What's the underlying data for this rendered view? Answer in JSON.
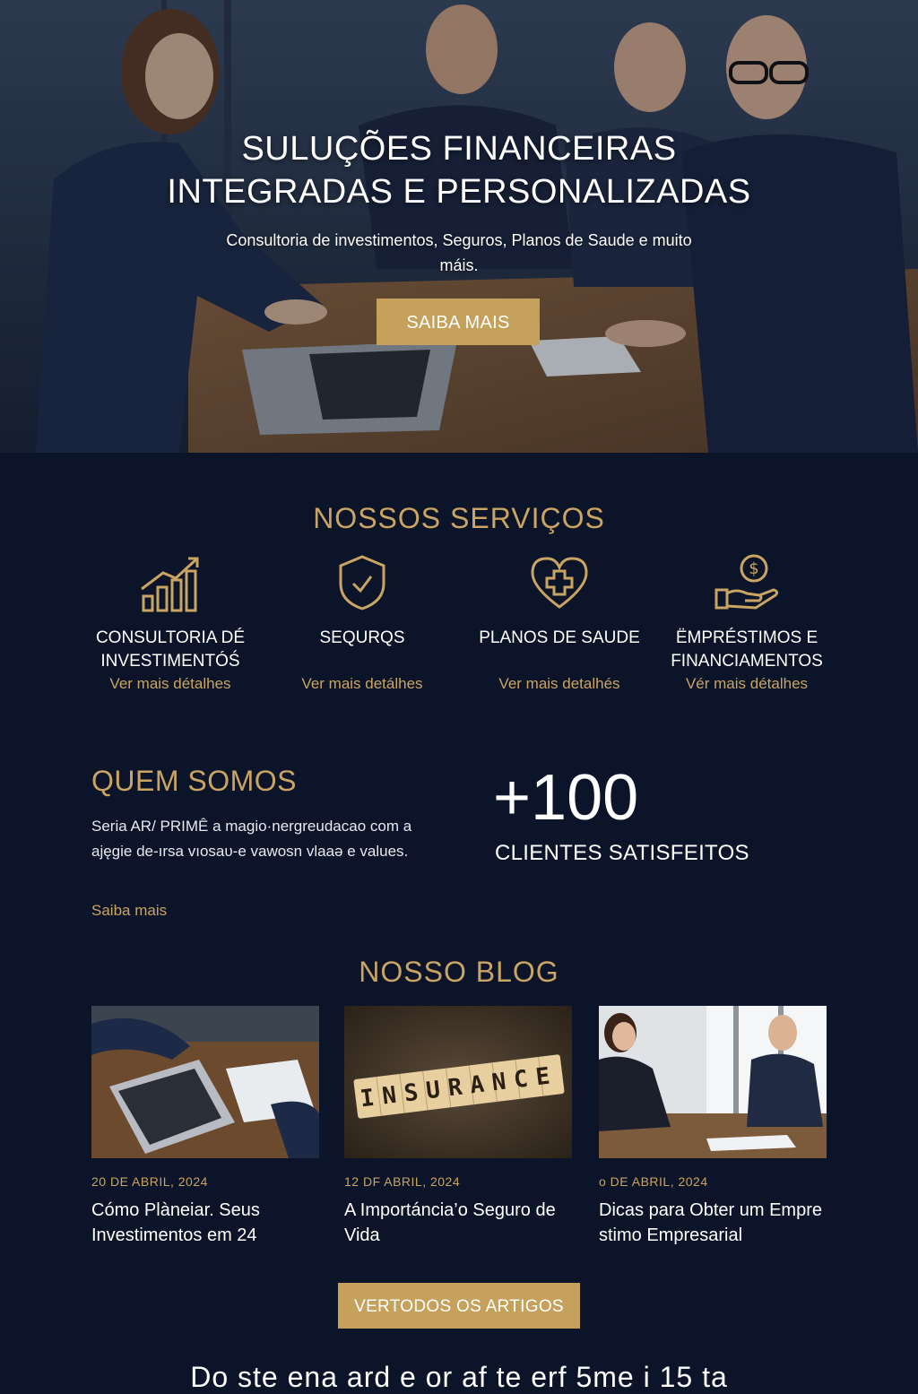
{
  "hero": {
    "title_line1": "SULUÇÕES FINANCEIRAS",
    "title_line2": "INTEGRADAS E PERSONALIZADAS",
    "subtitle": "Consultoria de investimentos, Seguros, Planos de Saude e muito máis.",
    "cta_label": "SAIBA MAIS"
  },
  "services": {
    "title": "NOSSOS SERVIÇOS",
    "items": [
      {
        "icon": "bar-chart-growth-icon",
        "name": "CONSULTORIA DÉ INVESTIMENTÓŚ",
        "link": "Ver mais détalhes"
      },
      {
        "icon": "shield-check-icon",
        "name": "SEQURQS",
        "link": "Ver mais detálhes"
      },
      {
        "icon": "heart-plus-icon",
        "name": "PLANOS DE SAUDE",
        "link": "Ver mais detalhés"
      },
      {
        "icon": "hand-coin-icon",
        "name": "ËMPRÉSTIMOS E FINANCIAMENTOS",
        "link": "Vér mais détalhes"
      }
    ]
  },
  "about": {
    "title": "QUEM SOMOS",
    "text": "Seria AR/ PRIMÊ a magio·nergreudacao com a ajęgie de-ırsa vıosaυ-e vawosn vlaaə e values.",
    "link": "Saiba mais",
    "stat_value": "+100",
    "stat_label": "CLIENTES SATISFEITOS"
  },
  "blog": {
    "title": "NOSSO BLOG",
    "posts": [
      {
        "date": "20 DE ABRIL, 2024",
        "title": "Cómo Plàneiar. Seus Investimentos em 24"
      },
      {
        "date": "12 DF ABRIL, 2024",
        "title": "A Importáncia’o Seguro de Vida"
      },
      {
        "date": "o DE ABRIL, 2024",
        "title": "Dicas para Obter um Empre stimo Empresarial"
      }
    ],
    "insurance_word": "INSURANCE",
    "all_label": "VERTODOS OS ARTIGOS"
  },
  "footer": {
    "cut_text": "Do ste ena ard e or af te erf 5me i 15 ta"
  },
  "colors": {
    "background": "#0b1428",
    "gold": "#c9a463",
    "button_gold": "#c6a15b"
  }
}
